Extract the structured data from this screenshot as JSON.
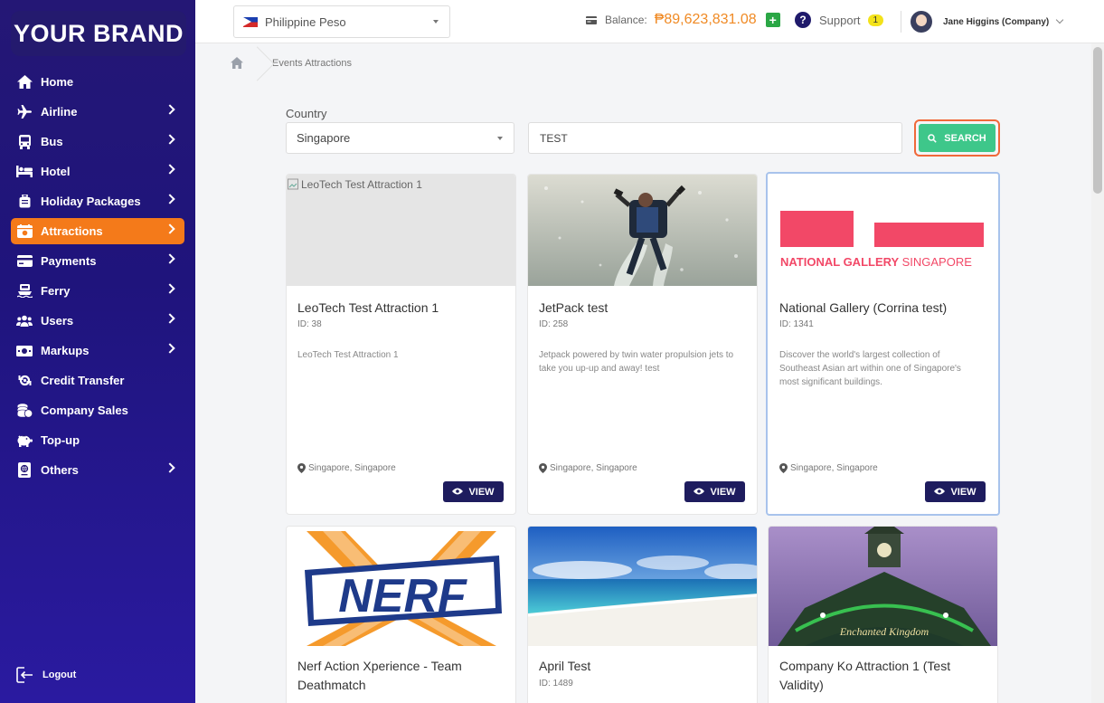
{
  "brand": "YOUR BRAND",
  "sidebar": {
    "items": [
      {
        "label": "Home",
        "icon": "home-icon",
        "chevron": false,
        "active": false
      },
      {
        "label": "Airline",
        "icon": "airplane-icon",
        "chevron": true,
        "active": false
      },
      {
        "label": "Bus",
        "icon": "bus-icon",
        "chevron": true,
        "active": false
      },
      {
        "label": "Hotel",
        "icon": "bed-icon",
        "chevron": true,
        "active": false
      },
      {
        "label": "Holiday Packages",
        "icon": "luggage-icon",
        "chevron": true,
        "active": false
      },
      {
        "label": "Attractions",
        "icon": "ticket-icon",
        "chevron": true,
        "active": true
      },
      {
        "label": "Payments",
        "icon": "credit-card-icon",
        "chevron": true,
        "active": false
      },
      {
        "label": "Ferry",
        "icon": "ferry-icon",
        "chevron": true,
        "active": false
      },
      {
        "label": "Users",
        "icon": "users-icon",
        "chevron": true,
        "active": false
      },
      {
        "label": "Markups",
        "icon": "money-icon",
        "chevron": true,
        "active": false
      },
      {
        "label": "Credit Transfer",
        "icon": "transfer-icon",
        "chevron": false,
        "active": false
      },
      {
        "label": "Company Sales",
        "icon": "coins-icon",
        "chevron": false,
        "active": false
      },
      {
        "label": "Top-up",
        "icon": "piggy-bank-icon",
        "chevron": false,
        "active": false
      },
      {
        "label": "Others",
        "icon": "passport-icon",
        "chevron": true,
        "active": false
      }
    ],
    "logout": "Logout"
  },
  "topbar": {
    "currency": "Philippine Peso",
    "balance_label": "Balance:",
    "balance_amount": "₱89,623,831.08",
    "support_label": "Support",
    "support_count": "1",
    "user_name": "Jane Higgins (Company)"
  },
  "breadcrumb": {
    "current": "Events Attractions"
  },
  "filters": {
    "country_label": "Country",
    "country_value": "Singapore",
    "search_value": "TEST",
    "search_button": "SEARCH"
  },
  "cards": [
    {
      "title": "LeoTech Test Attraction 1",
      "id": "ID: 38",
      "desc": "LeoTech Test Attraction 1",
      "location": "Singapore, Singapore",
      "view": "VIEW",
      "img_alt": "LeoTech Test Attraction 1"
    },
    {
      "title": "JetPack test",
      "id": "ID: 258",
      "desc": "Jetpack powered by twin water propulsion jets to take you up-up and away! test",
      "location": "Singapore, Singapore",
      "view": "VIEW"
    },
    {
      "title": "National Gallery (Corrina test)",
      "id": "ID: 1341",
      "desc": "Discover the world's largest collection of Southeast Asian art within one of Singapore's most significant buildings.",
      "location": "Singapore, Singapore",
      "view": "VIEW",
      "logo_text_a": "NATIONAL GALLERY",
      "logo_text_b": "SINGAPORE"
    },
    {
      "title": "Nerf Action Xperience - Team Deathmatch",
      "logo_text": "NERF"
    },
    {
      "title": "April Test",
      "id": "ID: 1489"
    },
    {
      "title": "Company Ko Attraction 1 (Test Validity)"
    }
  ]
}
